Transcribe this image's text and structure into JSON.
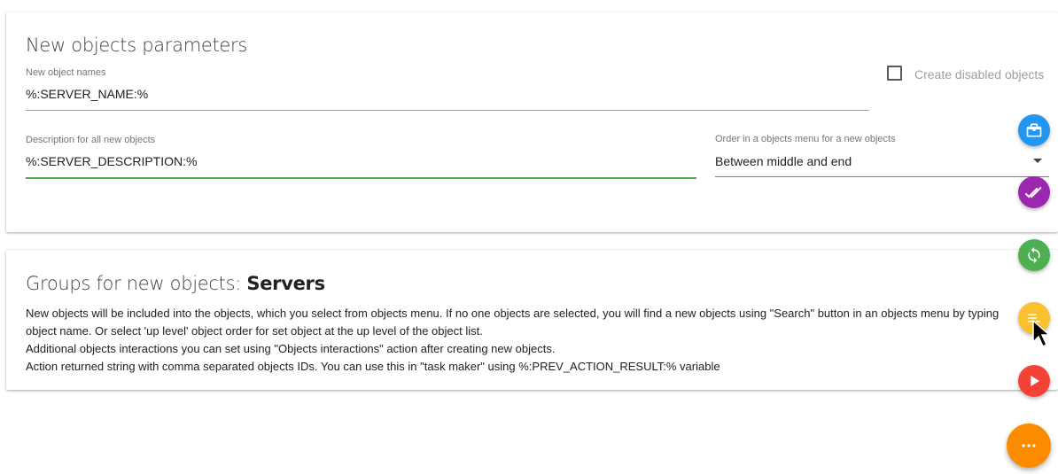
{
  "parameters_card": {
    "title": "New objects parameters",
    "names_field": {
      "label": "New object names",
      "value": "%:SERVER_NAME:%"
    },
    "create_disabled": {
      "label": "Create disabled objects",
      "checked": false
    },
    "description_field": {
      "label": "Description for all new objects",
      "value": "%:SERVER_DESCRIPTION:%"
    },
    "order_select": {
      "label": "Order in a objects menu for a new objects",
      "value": "Between middle and end"
    }
  },
  "groups_card": {
    "title_prefix": "Groups for new objects: ",
    "title_group": "Servers",
    "lines": [
      "New objects will be included into the objects, which you select from objects menu. If no one objects are selected, you will find a new objects using \"Search\" button in an objects menu by typing",
      "object name. Or select 'up level' object order for set object at the up level of the object list.",
      "Additional objects interactions you can set using \"Objects interactions\" action after creating new objects.",
      "Action returned string with comma separated objects IDs. You can use this in \"task maker\" using %:PREV_ACTION_RESULT:% variable"
    ]
  },
  "fab_buttons": [
    {
      "icon": "briefcase-icon",
      "color": "#2196f3"
    },
    {
      "icon": "double-check-icon",
      "color": "#9c27b0"
    },
    {
      "icon": "sync-icon",
      "color": "#4caf50"
    },
    {
      "icon": "playlist-icon",
      "color": "#fbc02d"
    },
    {
      "icon": "play-icon",
      "color": "#f44336"
    },
    {
      "icon": "more-horizontal-icon",
      "color": "#fb8c00"
    }
  ]
}
